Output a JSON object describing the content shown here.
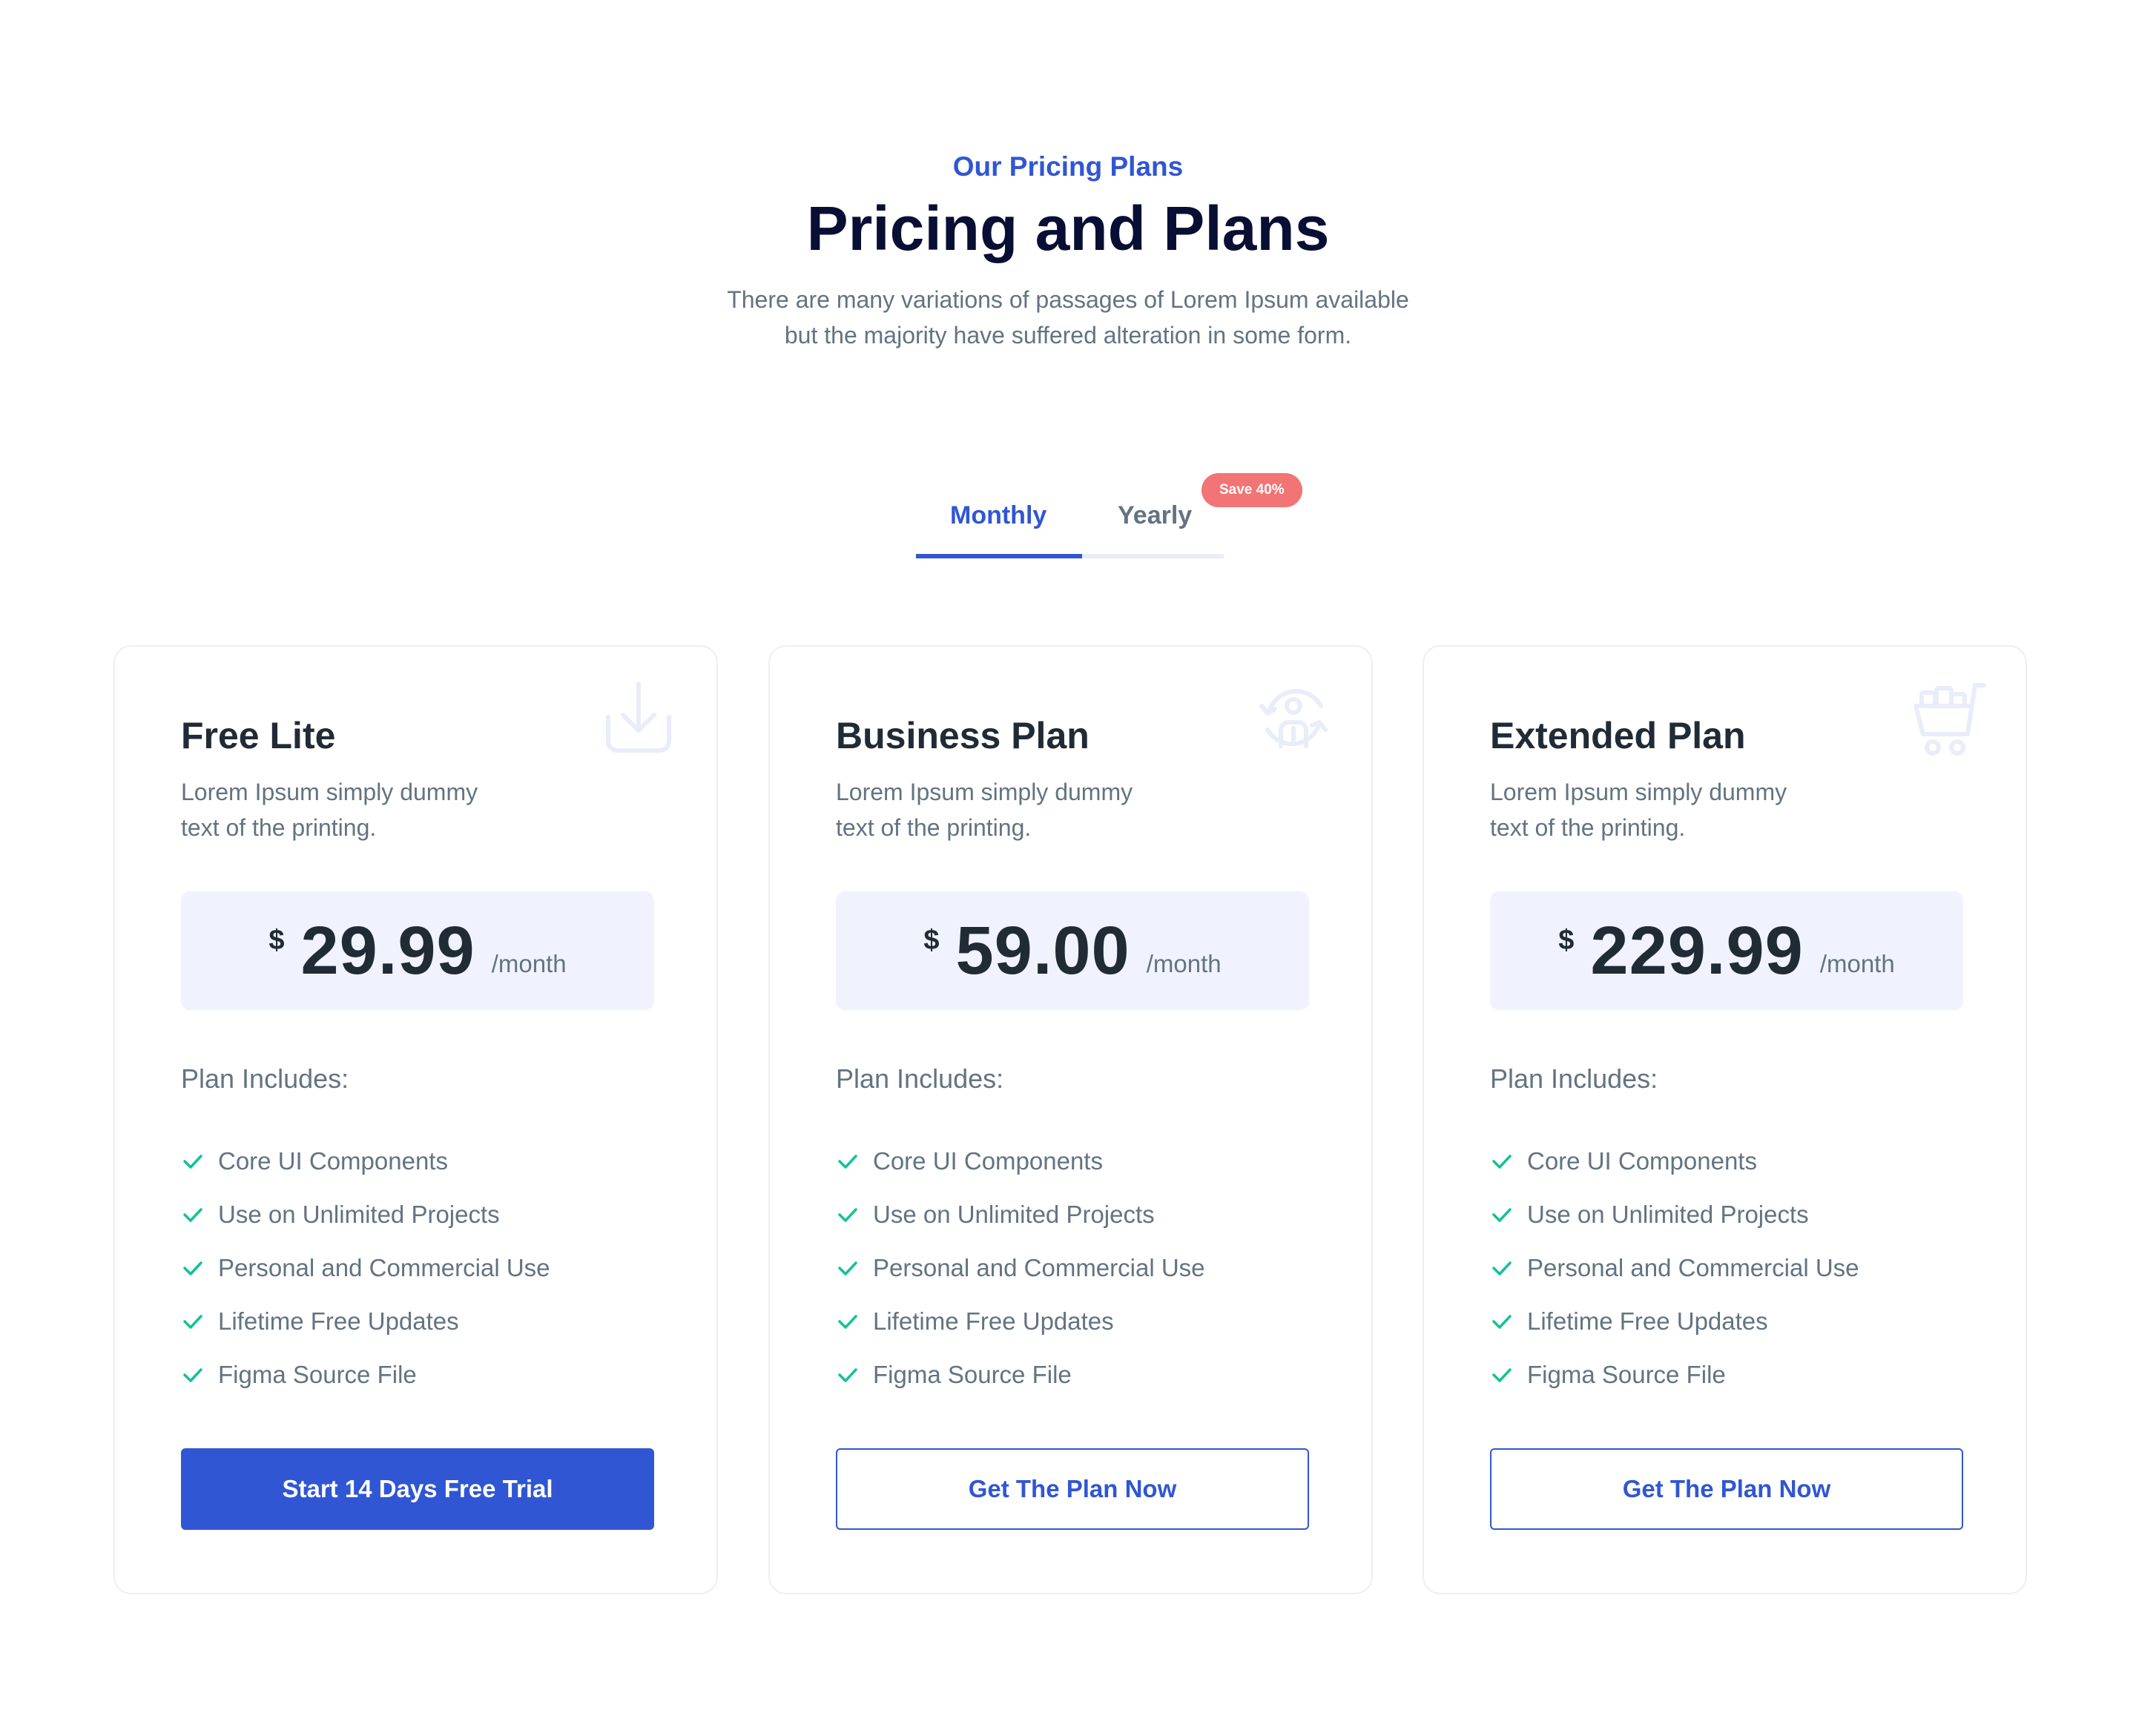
{
  "header": {
    "kicker": "Our Pricing Plans",
    "title": "Pricing and Plans",
    "subtitle_lines": [
      "There are many variations of passages of Lorem Ipsum available",
      "but the majority have suffered alteration in some form."
    ]
  },
  "billing_toggle": {
    "tabs": [
      {
        "label": "Monthly",
        "active": true
      },
      {
        "label": "Yearly",
        "active": false
      }
    ],
    "badge": "Save 40%"
  },
  "colors": {
    "accent": "#3056d3",
    "heading": "#090e34",
    "body_text": "#637381",
    "badge": "#f27474",
    "check": "#13c296",
    "price_bg": "#f0f3fd"
  },
  "plans": [
    {
      "icon": "download-tray-icon",
      "name": "Free Lite",
      "desc_lines": [
        "Lorem Ipsum simply dummy",
        "text of the printing."
      ],
      "currency": "$",
      "amount": "29.99",
      "period": "/month",
      "includes_label": "Plan Includes:",
      "features": [
        "Core UI Components",
        "Use on Unlimited Projects",
        "Personal and Commercial Use",
        "Lifetime Free Updates",
        "Figma Source File"
      ],
      "cta": "Start 14 Days Free Trial",
      "cta_style": "primary"
    },
    {
      "icon": "user-cycle-icon",
      "name": "Business Plan",
      "desc_lines": [
        "Lorem Ipsum simply dummy",
        "text of the printing."
      ],
      "currency": "$",
      "amount": "59.00",
      "period": "/month",
      "includes_label": "Plan Includes:",
      "features": [
        "Core UI Components",
        "Use on Unlimited Projects",
        "Personal and Commercial Use",
        "Lifetime Free Updates",
        "Figma Source File"
      ],
      "cta": "Get The Plan Now",
      "cta_style": "outline"
    },
    {
      "icon": "shopping-cart-icon",
      "name": "Extended Plan",
      "desc_lines": [
        "Lorem Ipsum simply dummy",
        "text of the printing."
      ],
      "currency": "$",
      "amount": "229.99",
      "period": "/month",
      "includes_label": "Plan Includes:",
      "features": [
        "Core UI Components",
        "Use on Unlimited Projects",
        "Personal and Commercial Use",
        "Lifetime Free Updates",
        "Figma Source File"
      ],
      "cta": "Get The Plan Now",
      "cta_style": "outline"
    }
  ]
}
